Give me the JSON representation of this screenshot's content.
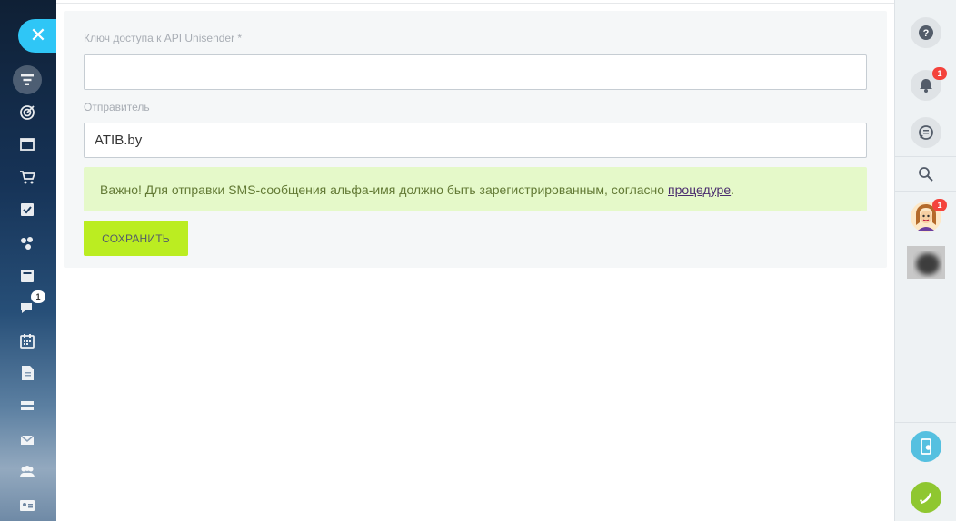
{
  "form": {
    "api_key_label": "Ключ доступа к API Unisender *",
    "api_key_value": "",
    "sender_label": "Отправитель",
    "sender_value": "ATIB.by",
    "notice_text": "Важно! Для отправки SMS-сообщения альфа-имя должно быть зарегистрированным, согласно",
    "notice_link": "процедуре",
    "notice_tail": ".",
    "save_label": "СОХРАНИТЬ"
  },
  "left_sidebar": {
    "items": [
      {
        "icon": "filter-icon",
        "active": true
      },
      {
        "icon": "target-icon"
      },
      {
        "icon": "window-icon"
      },
      {
        "icon": "cart-icon"
      },
      {
        "icon": "checkbox-icon"
      },
      {
        "icon": "pie-chart-icon"
      },
      {
        "icon": "card-icon"
      },
      {
        "icon": "chat-icon",
        "badge": "1"
      },
      {
        "icon": "calendar-icon"
      },
      {
        "icon": "document-icon"
      },
      {
        "icon": "storage-icon"
      },
      {
        "icon": "mail-icon"
      },
      {
        "icon": "group-icon"
      },
      {
        "icon": "contact-card-icon"
      }
    ]
  },
  "right_sidebar": {
    "notifications_badge": "1",
    "avatar_badge": "1"
  },
  "colors": {
    "accent": "#2fc6f6",
    "save_button": "#bbed21",
    "notice_bg": "#e5f9c9",
    "badge": "#f4433c",
    "call_button": "#8fc730"
  }
}
